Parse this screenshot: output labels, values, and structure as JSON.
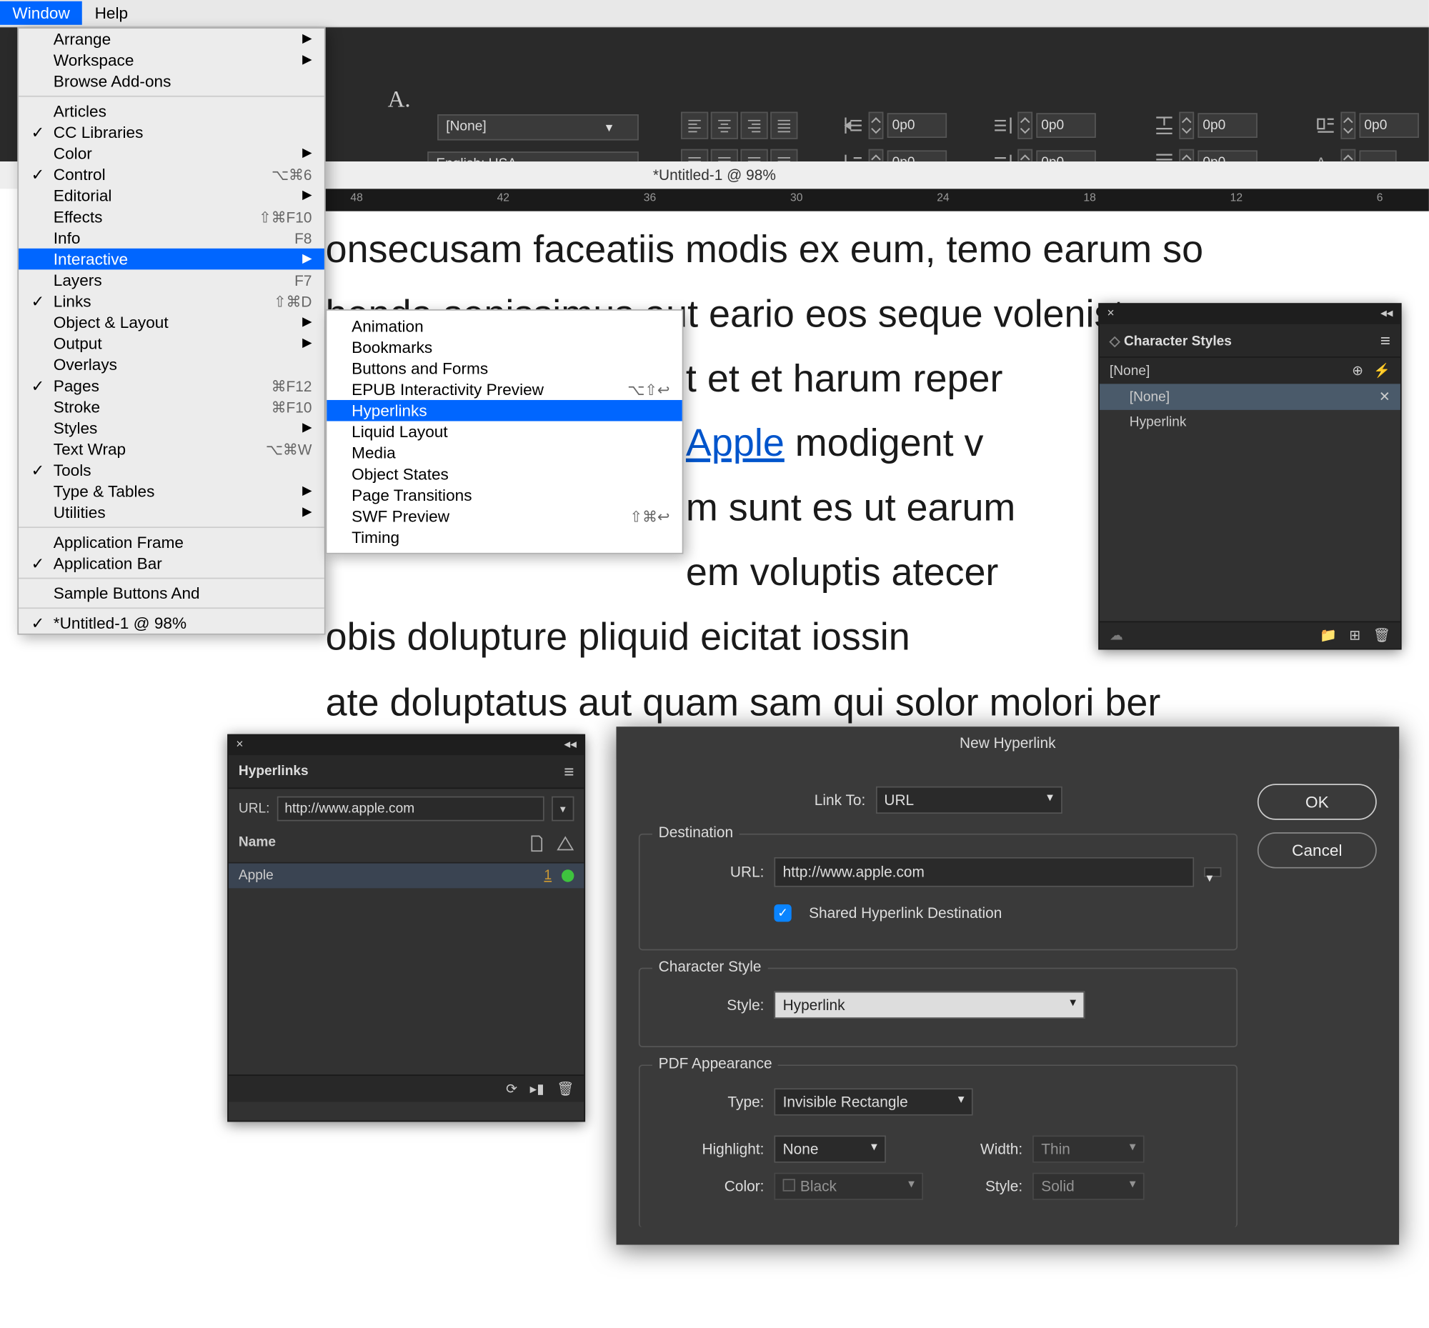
{
  "menubar": {
    "window": "Window",
    "help": "Help"
  },
  "window_menu": {
    "arrange": "Arrange",
    "workspace": "Workspace",
    "browse_addons": "Browse Add-ons",
    "articles": "Articles",
    "cc_libraries": "CC Libraries",
    "color": "Color",
    "control": "Control",
    "control_sc": "⌥⌘6",
    "editorial": "Editorial",
    "effects": "Effects",
    "effects_sc": "⇧⌘F10",
    "info": "Info",
    "info_sc": "F8",
    "interactive": "Interactive",
    "layers": "Layers",
    "layers_sc": "F7",
    "links": "Links",
    "links_sc": "⇧⌘D",
    "object_layout": "Object & Layout",
    "output": "Output",
    "overlays": "Overlays",
    "pages": "Pages",
    "pages_sc": "⌘F12",
    "stroke": "Stroke",
    "stroke_sc": "⌘F10",
    "styles": "Styles",
    "text_wrap": "Text Wrap",
    "text_wrap_sc": "⌥⌘W",
    "tools": "Tools",
    "type_tables": "Type & Tables",
    "utilities": "Utilities",
    "app_frame": "Application Frame",
    "app_bar": "Application Bar",
    "sample_btns": "Sample Buttons And ",
    "doc_window": "*Untitled-1 @ 98%"
  },
  "interactive_submenu": {
    "animation": "Animation",
    "bookmarks": "Bookmarks",
    "buttons_forms": "Buttons and Forms",
    "epub_preview": "EPUB Interactivity Preview",
    "epub_sc": "⌥⇧↩",
    "hyperlinks": "Hyperlinks",
    "liquid_layout": "Liquid Layout",
    "media": "Media",
    "object_states": "Object States",
    "page_transitions": "Page Transitions",
    "swf_preview": "SWF Preview",
    "swf_sc": "⇧⌘↩",
    "timing": "Timing"
  },
  "toolbar": {
    "style_none": "[None]",
    "language": "English: USA",
    "sp0": "0p0"
  },
  "doc_title": "*Untitled-1 @ 98%",
  "ruler": {
    "t48": "48",
    "t42": "42",
    "t36": "36",
    "t30": "30",
    "t24": "24",
    "t18": "18",
    "t12": "12",
    "t6": "6"
  },
  "doc_text": {
    "l1": "onsecusam faceatiis modis ex eum, temo earum so",
    "l2": "henda senissimus aut eario eos seque volenistem",
    "l3a": "t et et harum repe",
    "l3b": "r",
    "l4_link": "Apple",
    "l4a": " modigent v",
    "l5": "m sunt es ut earum",
    "l6": "em voluptis atecer",
    "l7": "obis dolupture pliquid eicitat iossin",
    "l8": "ate doluptatus aut quam sam qui solor molori ber"
  },
  "char_styles": {
    "title": "Character Styles",
    "none_header": "[None]",
    "none": "[None]",
    "hyperlink": "Hyperlink"
  },
  "hyperlinks_panel": {
    "title": "Hyperlinks",
    "url_label": "URL:",
    "url_value": "http://www.apple.com",
    "name_header": "Name",
    "item_name": "Apple",
    "item_count": "1"
  },
  "dialog": {
    "title": "New Hyperlink",
    "link_to_label": "Link To:",
    "link_to_value": "URL",
    "ok": "OK",
    "cancel": "Cancel",
    "destination_section": "Destination",
    "url_label": "URL:",
    "url_value": "http://www.apple.com",
    "shared_label": "Shared Hyperlink Destination",
    "char_style_section": "Character Style",
    "style_label": "Style:",
    "style_value": "Hyperlink",
    "pdf_section": "PDF Appearance",
    "type_label": "Type:",
    "type_value": "Invisible Rectangle",
    "highlight_label": "Highlight:",
    "highlight_value": "None",
    "color_label": "Color:",
    "color_value": "Black",
    "width_label": "Width:",
    "width_value": "Thin",
    "pdf_style_label": "Style:",
    "pdf_style_value": "Solid"
  }
}
